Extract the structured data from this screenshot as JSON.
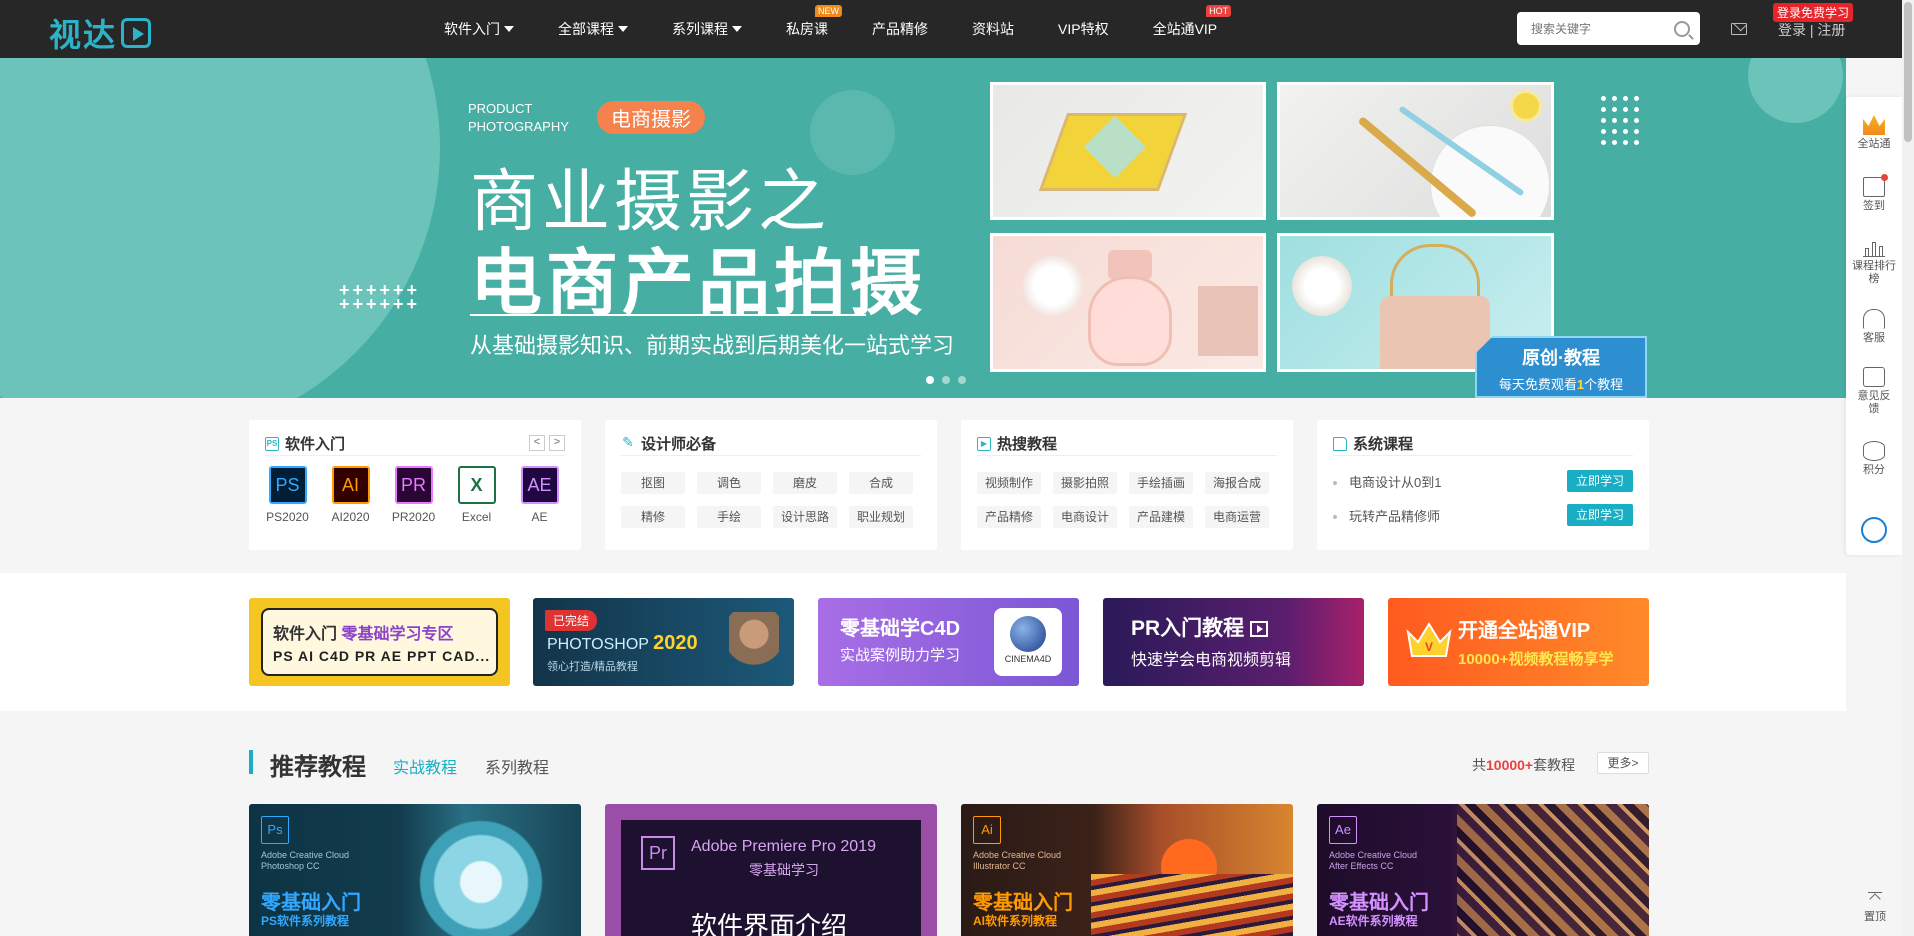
{
  "header": {
    "logo": "视达",
    "nav": [
      {
        "label": "软件入门",
        "caret": true
      },
      {
        "label": "全部课程",
        "caret": true
      },
      {
        "label": "系列课程",
        "caret": true
      },
      {
        "label": "私房课",
        "badge": "NEW"
      },
      {
        "label": "产品精修"
      },
      {
        "label": "资料站"
      },
      {
        "label": "VIP特权"
      },
      {
        "label": "全站通VIP",
        "badge": "HOT"
      }
    ],
    "search_placeholder": "搜索关键字",
    "login_free": "登录免费学习",
    "login": "登录",
    "separator": "|",
    "register": "注册"
  },
  "banner": {
    "en_line1": "PRODUCT",
    "en_line2": "PHOTOGRAPHY",
    "tag": "电商摄影",
    "title1": "商业摄影之",
    "title2": "电商产品拍摄",
    "subtitle": "从基础摄影知识、前期实战到后期美化一站式学习",
    "plus_row": "++++++",
    "promo_title": "原创·教程",
    "promo_prefix": "每天免费观看",
    "promo_num": "1",
    "promo_suffix": "个教程",
    "slides": 3,
    "active_slide": 0
  },
  "cards": {
    "software": {
      "title": "软件入门",
      "prev": "<",
      "next": ">",
      "items": [
        {
          "abbr": "PS",
          "label": "PS2020",
          "color": "#31a8ff",
          "bg": "#001e36"
        },
        {
          "abbr": "AI",
          "label": "AI2020",
          "color": "#ff9a00",
          "bg": "#330000"
        },
        {
          "abbr": "PR",
          "label": "PR2020",
          "color": "#ea77ff",
          "bg": "#2a0634"
        },
        {
          "abbr": "X",
          "label": "Excel",
          "color": "#1e7145",
          "bg": "#ffffff"
        },
        {
          "abbr": "AE",
          "label": "AE",
          "color": "#d291ff",
          "bg": "#1f0740"
        }
      ]
    },
    "designer": {
      "title": "设计师必备",
      "tags": [
        "抠图",
        "调色",
        "磨皮",
        "合成",
        "精修",
        "手绘",
        "设计思路",
        "职业规划"
      ]
    },
    "hot": {
      "title": "热搜教程",
      "tags": [
        "视频制作",
        "摄影拍照",
        "手绘插画",
        "海报合成",
        "产品精修",
        "电商设计",
        "产品建模",
        "电商运营"
      ]
    },
    "series": {
      "title": "系统课程",
      "rows": [
        {
          "label": "电商设计从0到1",
          "button": "立即学习"
        },
        {
          "label": "玩转产品精修师",
          "button": "立即学习"
        }
      ]
    }
  },
  "promos": {
    "p1": {
      "a": "软件入门",
      "b": "零基础学习专区",
      "c": "PS AI C4D PR AE PPT CAD..."
    },
    "p2": {
      "done": "已完结",
      "title_prefix": "PHOTOSHOP",
      "title_year": "2020",
      "sub": "领心打造/精品教程"
    },
    "p3": {
      "title": "零基础学C4D",
      "sub": "实战案例助力学习",
      "logo": "CINEMA4D"
    },
    "p4": {
      "title": "PR入门教程",
      "sub": "快速学会电商视频剪辑"
    },
    "p5": {
      "title": "开通全站通VIP",
      "sub": "10000+视频教程畅享学"
    }
  },
  "recommend": {
    "title": "推荐教程",
    "tabs": [
      "实战教程",
      "系列教程"
    ],
    "active_tab": 0,
    "count_prefix": "共",
    "count": "10000+",
    "count_suffix": "套教程",
    "more": "更多>",
    "courses": [
      {
        "abbr": "Ps",
        "meta1": "Adobe Creative Cloud",
        "meta2": "Photoshop CC",
        "big": "零基础入门",
        "small": "PS软件系列教程",
        "accent": "#31a8ff"
      },
      {
        "abbr": "Pr",
        "name": "Adobe Premiere Pro 2019",
        "zero": "零基础学习",
        "iface": "软件界面介绍"
      },
      {
        "abbr": "Ai",
        "meta1": "Adobe Creative Cloud",
        "meta2": "Illustrator CC",
        "big": "零基础入门",
        "small": "AI软件系列教程",
        "accent": "#ff9a00"
      },
      {
        "abbr": "Ae",
        "meta1": "Adobe Creative Cloud",
        "meta2": "After Effects CC",
        "big": "零基础入门",
        "small": "AE软件系列教程",
        "accent": "#d291ff"
      }
    ]
  },
  "sidebar": {
    "items": [
      {
        "label": "全站通",
        "icon": "crown-icon"
      },
      {
        "label": "签到",
        "icon": "calendar-icon"
      },
      {
        "label": "课程排行榜",
        "icon": "ranking-icon"
      },
      {
        "label": "客服",
        "icon": "headset-icon"
      },
      {
        "label": "意见反馈",
        "icon": "feedback-icon"
      },
      {
        "label": "积分",
        "icon": "coin-icon"
      }
    ],
    "top": "置顶"
  }
}
